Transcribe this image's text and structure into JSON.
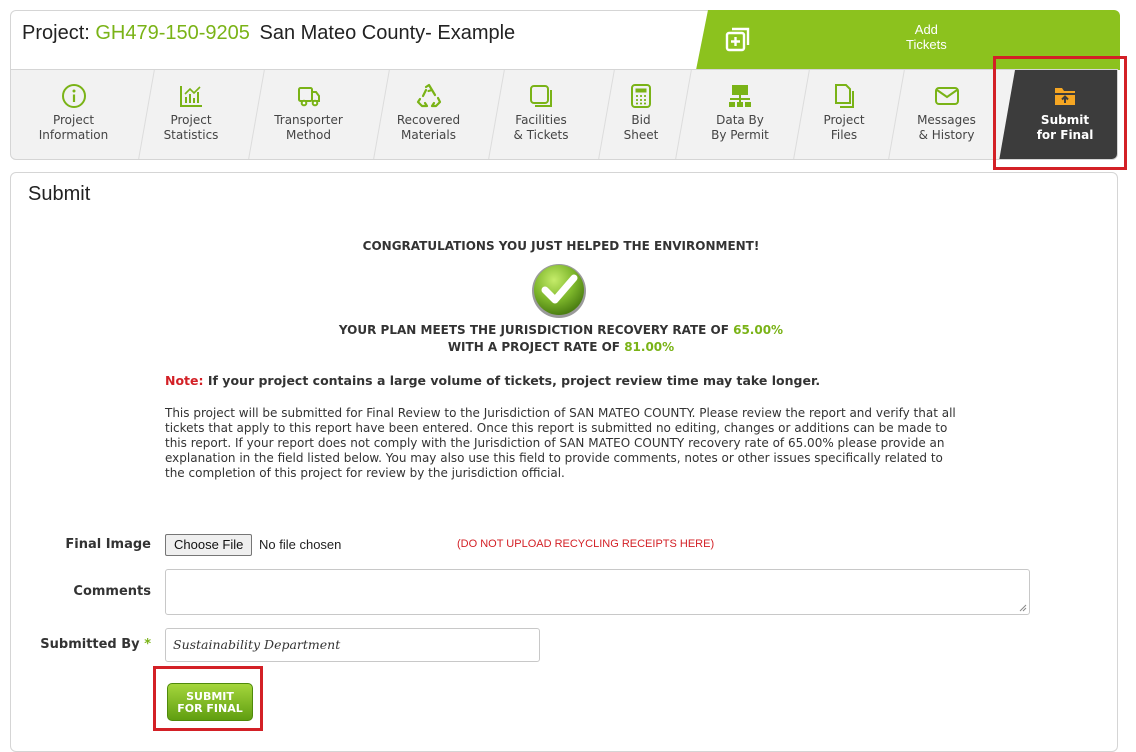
{
  "project": {
    "label": "Project:",
    "code": "GH479-150-9205",
    "name": "San Mateo County- Example"
  },
  "add_tickets": {
    "line1": "Add",
    "line2": "Tickets"
  },
  "nav": [
    {
      "id": "project-information",
      "line1": "Project",
      "line2": "Information",
      "icon": "info-icon"
    },
    {
      "id": "project-statistics",
      "line1": "Project",
      "line2": "Statistics",
      "icon": "chart-icon"
    },
    {
      "id": "transporter-method",
      "line1": "Transporter",
      "line2": "Method",
      "icon": "truck-icon"
    },
    {
      "id": "recovered-materials",
      "line1": "Recovered",
      "line2": "Materials",
      "icon": "recycle-icon"
    },
    {
      "id": "facilities-tickets",
      "line1": "Facilities",
      "line2": "& Tickets",
      "icon": "ticket-icon"
    },
    {
      "id": "bid-sheet",
      "line1": "Bid",
      "line2": "Sheet",
      "icon": "calculator-icon"
    },
    {
      "id": "data-by-permit",
      "line1": "Data By",
      "line2": "By Permit",
      "icon": "network-icon"
    },
    {
      "id": "project-files",
      "line1": "Project",
      "line2": "Files",
      "icon": "files-icon"
    },
    {
      "id": "messages-history",
      "line1": "Messages",
      "line2": "& History",
      "icon": "mail-icon"
    },
    {
      "id": "submit-for-final",
      "line1": "Submit",
      "line2": "for Final",
      "icon": "upload-folder-icon",
      "active": true
    }
  ],
  "panel_title": "Submit",
  "congrats": "CONGRATULATIONS YOU JUST HELPED THE ENVIRONMENT!",
  "rate": {
    "line1_text": "YOUR PLAN MEETS THE JURISDICTION RECOVERY RATE OF ",
    "line1_value": "65.00%",
    "line2_text": "WITH A PROJECT RATE OF ",
    "line2_value": "81.00%"
  },
  "note": {
    "label": "Note:",
    "text": " If your project contains a large volume of tickets, project review time may take longer."
  },
  "description": "This project will be submitted for Final Review to the Jurisdiction of SAN MATEO COUNTY. Please review the report and verify that all tickets that apply to this report have been entered. Once this report is submitted no editing, changes or additions can be made to this report. If your report does not comply with the Jurisdiction of SAN MATEO COUNTY recovery rate of 65.00% please provide an explanation in the field listed below. You may also use this field to provide comments, notes or other issues specifically related to the completion of this project for review by the jurisdiction official.",
  "form": {
    "final_image_label": "Final Image",
    "choose_file": "Choose File",
    "file_status": "No file chosen",
    "warning": "(DO NOT UPLOAD RECYCLING RECEIPTS HERE)",
    "comments_label": "Comments",
    "comments_value": "",
    "submitted_by_label": "Submitted By",
    "required_mark": "*",
    "submitted_by_value": "Sustainability Department"
  },
  "submit_button": {
    "line1": "SUBMIT",
    "line2": "FOR FINAL"
  },
  "colors": {
    "accent_green": "#8cc21e",
    "highlight_red": "#d32026",
    "active_tab": "#3c3c3c"
  }
}
